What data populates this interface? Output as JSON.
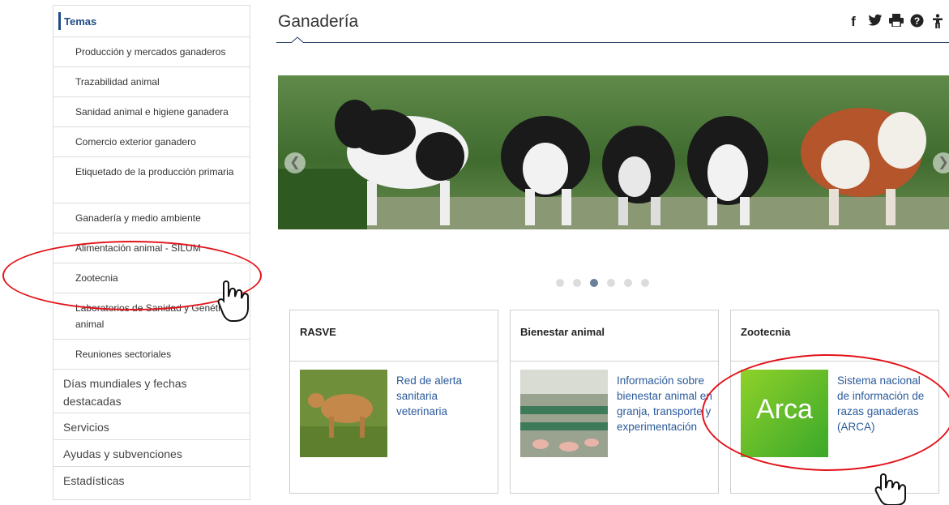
{
  "sidebar": {
    "header": "Temas",
    "subitems": [
      "Producción y mercados ganaderos",
      "Trazabilidad animal",
      "Sanidad animal e higiene ganadera",
      "Comercio exterior ganadero",
      "Etiquetado de la producción primaria",
      "Ganadería y medio ambiente",
      "Alimentación animal - SILUM",
      "Zootecnia",
      "Laboratorios de Sanidad y Genética animal",
      "Reuniones sectoriales"
    ],
    "top_items": [
      "Días mundiales y fechas destacadas",
      "Servicios",
      "Ayudas y subvenciones",
      "Estadísticas"
    ]
  },
  "header": {
    "title": "Ganadería",
    "share_icons": [
      "facebook-icon",
      "twitter-icon",
      "print-icon",
      "help-icon",
      "accessibility-icon"
    ]
  },
  "carousel": {
    "slide_count": 6,
    "active_index": 2
  },
  "cards": [
    {
      "title": "RASVE",
      "text": "Red de alerta sanitaria veterinaria"
    },
    {
      "title": "Bienestar animal",
      "text": "Información sobre bienestar animal en granja, transporte y experimentación"
    },
    {
      "title": "Zootecnia",
      "text": "Sistema nacional de información de razas ganaderas (ARCA)",
      "logo": "Arca"
    }
  ],
  "colors": {
    "accent": "#1f4a86",
    "link": "#2a5a9b",
    "annotation": "#e2131a"
  }
}
